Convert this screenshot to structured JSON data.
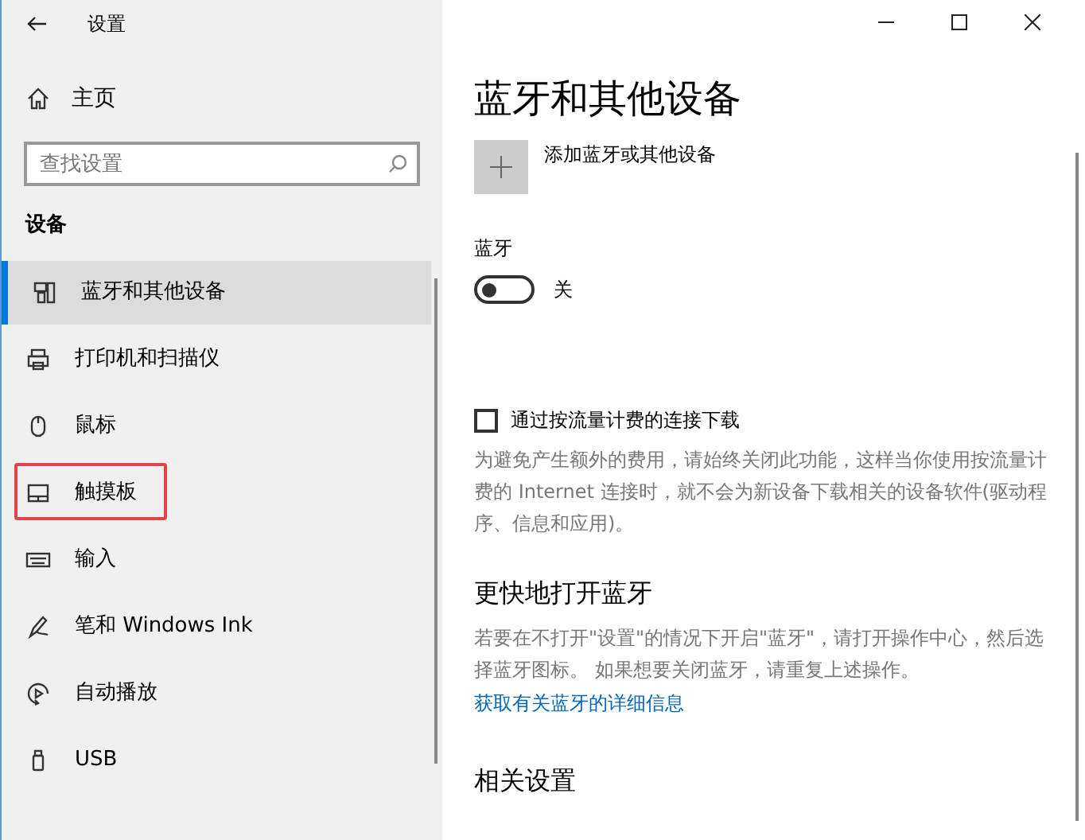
{
  "window": {
    "title": "设置",
    "controls": [
      {
        "kind": "minimize"
      },
      {
        "kind": "maximize"
      },
      {
        "kind": "close"
      }
    ]
  },
  "sidebar": {
    "home": "主页",
    "search": {
      "placeholder": "查找设置"
    },
    "section": "设备",
    "items": [
      {
        "label": "蓝牙和其他设备",
        "kind": "bluetooth",
        "selected": true,
        "highlighted": false
      },
      {
        "label": "打印机和扫描仪",
        "kind": "printer",
        "selected": false,
        "highlighted": false
      },
      {
        "label": "鼠标",
        "kind": "mouse",
        "selected": false,
        "highlighted": false
      },
      {
        "label": "触摸板",
        "kind": "touchpad",
        "selected": false,
        "highlighted": true
      },
      {
        "label": "输入",
        "kind": "keyboard",
        "selected": false,
        "highlighted": false
      },
      {
        "label": "笔和 Windows Ink",
        "kind": "pen",
        "selected": false,
        "highlighted": false
      },
      {
        "label": "自动播放",
        "kind": "autoplay",
        "selected": false,
        "highlighted": false
      },
      {
        "label": "USB",
        "kind": "usb",
        "selected": false,
        "highlighted": false
      }
    ]
  },
  "main": {
    "title": "蓝牙和其他设备",
    "add_device": "添加蓝牙或其他设备",
    "bluetooth": {
      "label": "蓝牙",
      "on": false,
      "state": "关"
    },
    "metered": {
      "label": "通过按流量计费的连接下载",
      "checked": false,
      "description": "为避免产生额外的费用，请始终关闭此功能，这样当你使用按流量计费的 Internet 连接时，就不会为新设备下载相关的设备软件(驱动程序、信息和应用)。"
    },
    "faster": {
      "heading": "更快地打开蓝牙",
      "description": "若要在不打开\"设置\"的情况下开启\"蓝牙\"，请打开操作中心，然后选择蓝牙图标。 如果想要关闭蓝牙，请重复上述操作。",
      "link": "获取有关蓝牙的详细信息"
    },
    "related": {
      "heading": "相关设置"
    }
  }
}
